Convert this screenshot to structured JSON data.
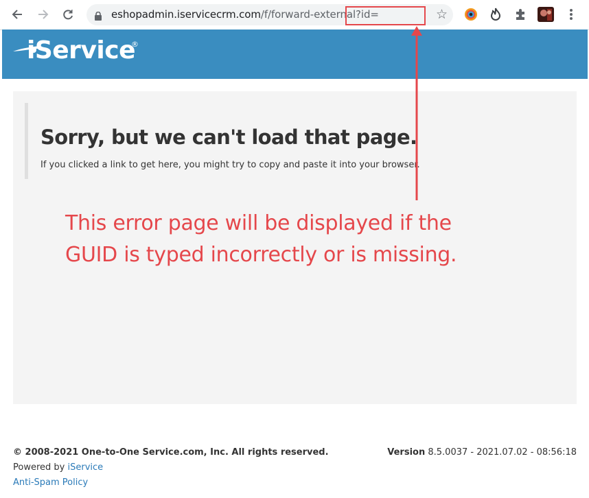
{
  "browser": {
    "url_host": "eshopadmin.iservicecrm.com",
    "url_path": "/f/forward-external?id=",
    "icons": {
      "back": "back-arrow-icon",
      "forward": "forward-arrow-icon",
      "reload": "reload-icon",
      "lock": "lock-icon",
      "bookmark": "star-icon",
      "extensions": "puzzle-icon",
      "menu": "kebab-menu-icon"
    }
  },
  "site": {
    "logo_text": "iService",
    "logo_registered": "®",
    "brand_color": "#3a8dc0"
  },
  "error": {
    "title": "Sorry, but we can't load that page.",
    "description": "If you clicked a link to get here, you might try to copy and paste it into your browser."
  },
  "annotation": {
    "line1": "This error page will be displayed if the",
    "line2": "GUID is typed incorrectly or is missing.",
    "color": "#e5474b"
  },
  "footer": {
    "copyright": "© 2008-2021 One-to-One Service.com, Inc. All rights reserved.",
    "powered_by_prefix": "Powered by ",
    "powered_by_link": "iService",
    "anti_spam_link": "Anti-Spam Policy",
    "version_label": "Version",
    "version_value": " 8.5.0037 - 2021.07.02 - 08:56:18"
  }
}
